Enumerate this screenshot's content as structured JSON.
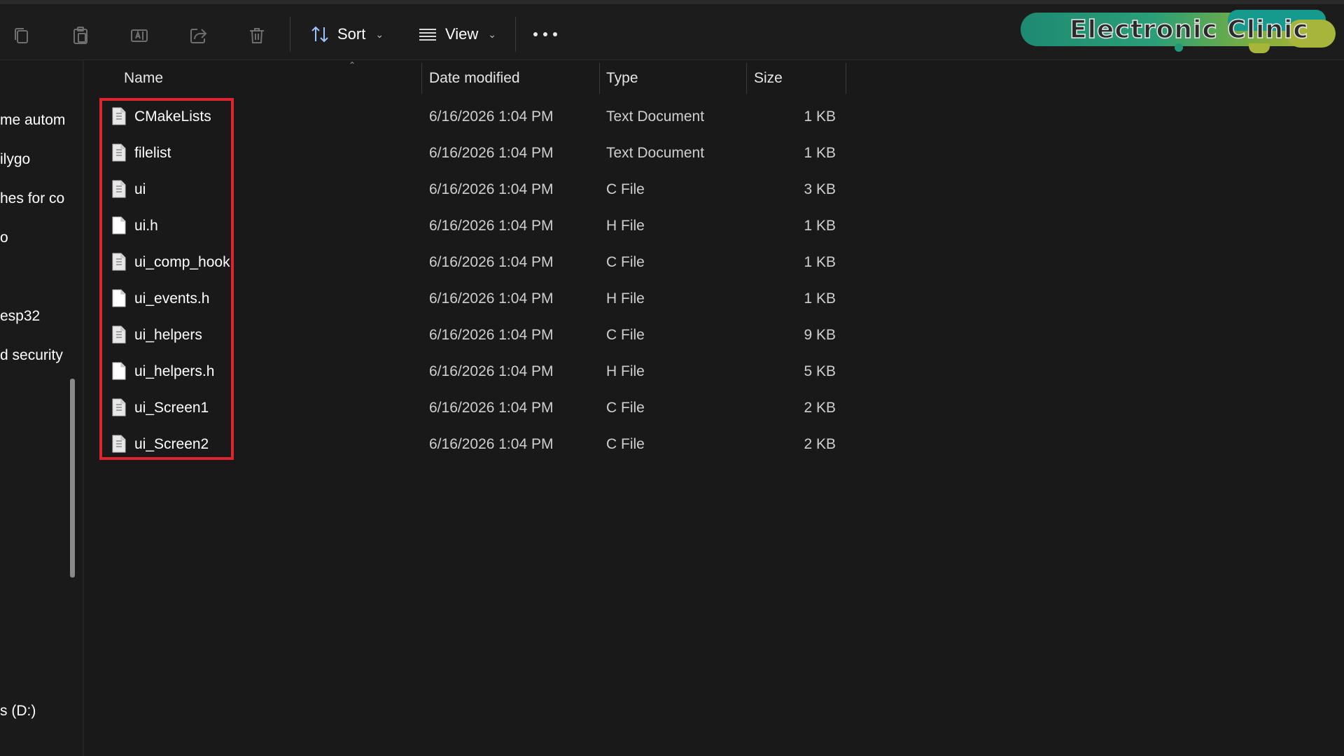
{
  "toolbar": {
    "icons": [
      "copy-icon",
      "paste-icon",
      "rename-icon",
      "share-icon",
      "delete-icon"
    ],
    "sort_label": "Sort",
    "view_label": "View",
    "more_label": "See more"
  },
  "watermark": {
    "text": "Electronic Clinic",
    "colors": [
      "#1e8a72",
      "#7cae3e",
      "#a9b13a"
    ]
  },
  "sidebar": {
    "items": [
      {
        "label": "me autom"
      },
      {
        "label": "ilygo"
      },
      {
        "label": "hes for co"
      },
      {
        "label": "o"
      },
      {
        "label": "esp32"
      },
      {
        "label": "d security"
      },
      {
        "label": "s (D:)"
      }
    ]
  },
  "columns": {
    "name": "Name",
    "date": "Date modified",
    "type": "Type",
    "size": "Size"
  },
  "files": [
    {
      "name": "CMakeLists",
      "date": "6/16/2026 1:04 PM",
      "type": "Text Document",
      "size": "1 KB",
      "icon": "text-file-icon"
    },
    {
      "name": "filelist",
      "date": "6/16/2026 1:04 PM",
      "type": "Text Document",
      "size": "1 KB",
      "icon": "text-file-icon"
    },
    {
      "name": "ui",
      "date": "6/16/2026 1:04 PM",
      "type": "C File",
      "size": "3 KB",
      "icon": "text-file-icon"
    },
    {
      "name": "ui.h",
      "date": "6/16/2026 1:04 PM",
      "type": "H File",
      "size": "1 KB",
      "icon": "blank-file-icon"
    },
    {
      "name": "ui_comp_hook",
      "date": "6/16/2026 1:04 PM",
      "type": "C File",
      "size": "1 KB",
      "icon": "text-file-icon"
    },
    {
      "name": "ui_events.h",
      "date": "6/16/2026 1:04 PM",
      "type": "H File",
      "size": "1 KB",
      "icon": "blank-file-icon"
    },
    {
      "name": "ui_helpers",
      "date": "6/16/2026 1:04 PM",
      "type": "C File",
      "size": "9 KB",
      "icon": "text-file-icon"
    },
    {
      "name": "ui_helpers.h",
      "date": "6/16/2026 1:04 PM",
      "type": "H File",
      "size": "5 KB",
      "icon": "blank-file-icon"
    },
    {
      "name": "ui_Screen1",
      "date": "6/16/2026 1:04 PM",
      "type": "C File",
      "size": "2 KB",
      "icon": "text-file-icon"
    },
    {
      "name": "ui_Screen2",
      "date": "6/16/2026 1:04 PM",
      "type": "C File",
      "size": "2 KB",
      "icon": "text-file-icon"
    }
  ],
  "highlight": {
    "color": "#e0242f"
  }
}
